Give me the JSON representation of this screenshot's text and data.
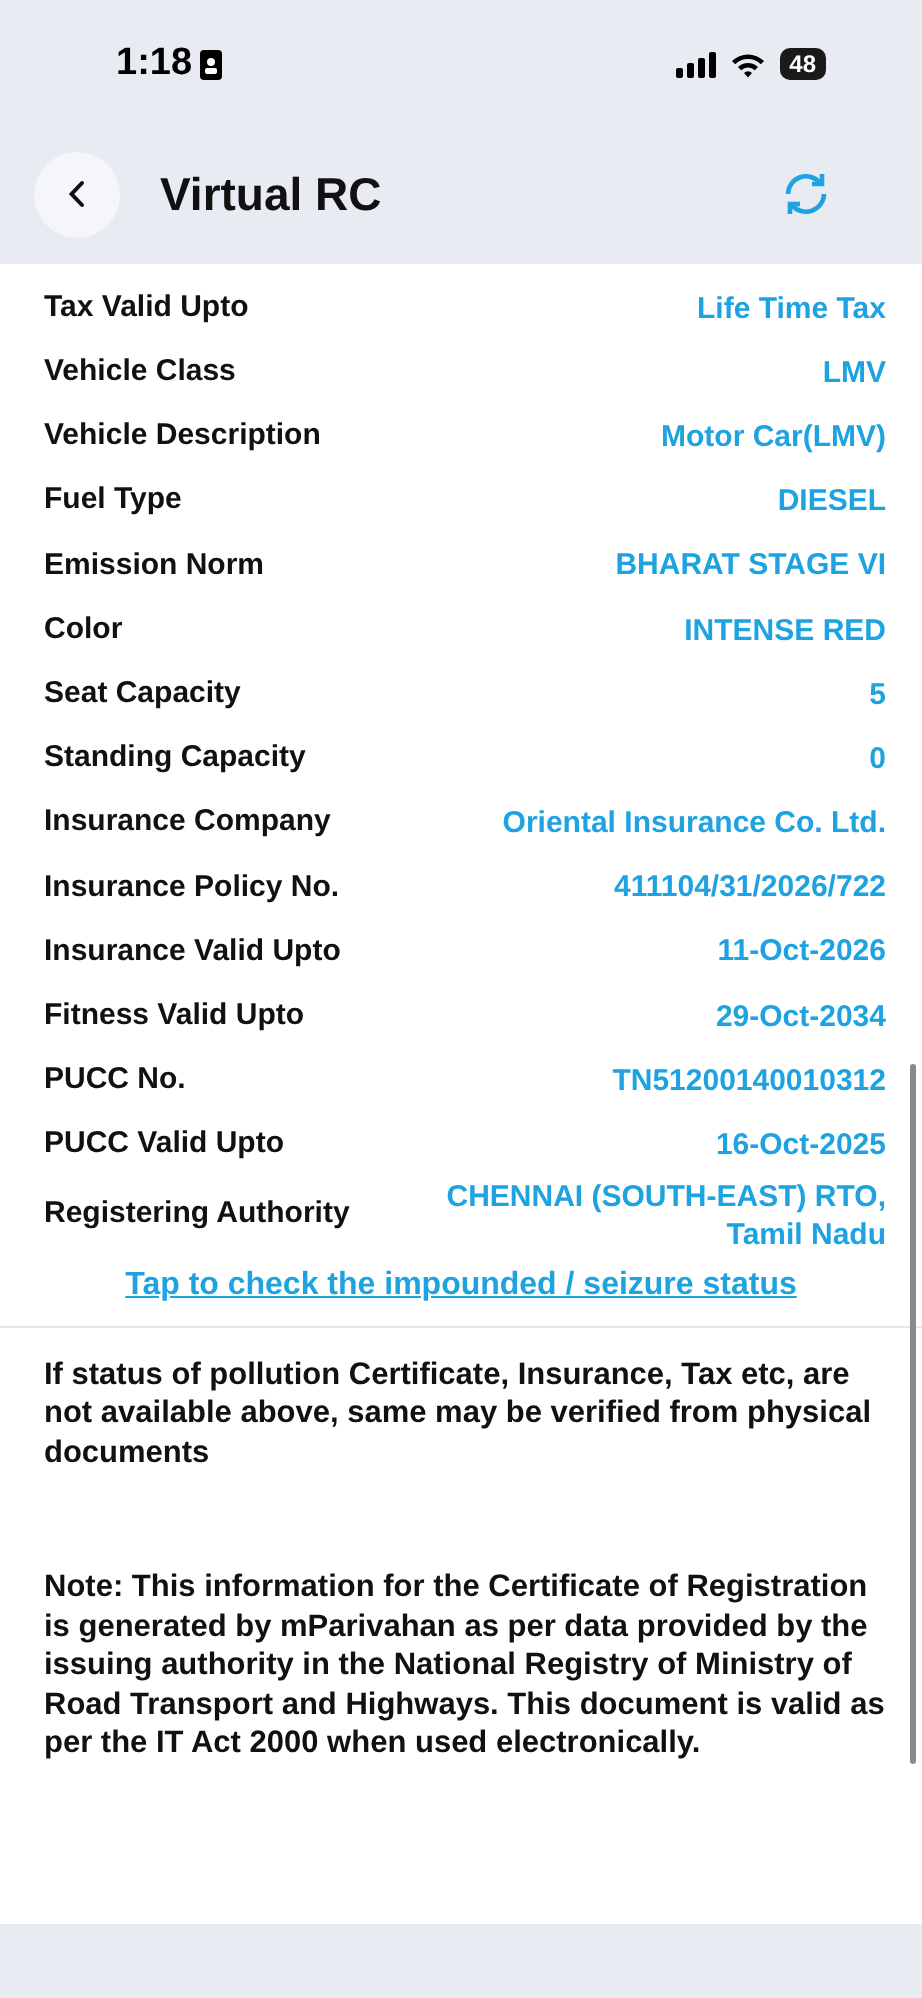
{
  "status_bar": {
    "time": "1:18",
    "battery": "48"
  },
  "header": {
    "title": "Virtual RC"
  },
  "details": [
    {
      "label": "Tax Valid Upto",
      "value": "Life Time Tax"
    },
    {
      "label": "Vehicle Class",
      "value": "LMV"
    },
    {
      "label": "Vehicle Description",
      "value": "Motor Car(LMV)"
    },
    {
      "label": "Fuel Type",
      "value": "DIESEL"
    },
    {
      "label": "Emission Norm",
      "value": "BHARAT STAGE VI"
    },
    {
      "label": "Color",
      "value": "INTENSE RED"
    },
    {
      "label": "Seat Capacity",
      "value": "5"
    },
    {
      "label": "Standing Capacity",
      "value": "0"
    },
    {
      "label": "Insurance Company",
      "value": "Oriental Insurance Co. Ltd."
    },
    {
      "label": "Insurance Policy No.",
      "value": "411104/31/2026/722"
    },
    {
      "label": "Insurance Valid Upto",
      "value": "11-Oct-2026"
    },
    {
      "label": "Fitness Valid Upto",
      "value": "29-Oct-2034"
    },
    {
      "label": "PUCC No.",
      "value": "TN51200140010312"
    },
    {
      "label": "PUCC Valid Upto",
      "value": "16-Oct-2025"
    },
    {
      "label": "Registering Authority",
      "value": "CHENNAI (SOUTH-EAST) RTO, Tamil Nadu"
    }
  ],
  "seizure_link": "Tap to check the impounded / seizure status",
  "notices": [
    "If status of pollution Certificate, Insurance, Tax etc, are not available above, same may be verified from physical documents",
    "Note:  This information for the Certificate of Registration is generated by mParivahan as per data provided by the issuing authority in the National Registry of Ministry of Road Transport and Highways. This document is valid as per the IT Act 2000 when used electronically."
  ]
}
